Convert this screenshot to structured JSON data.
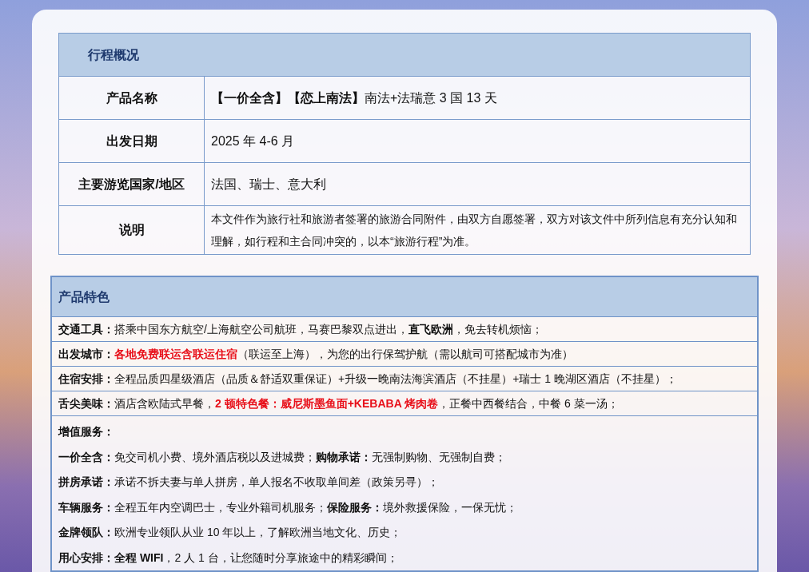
{
  "overview": {
    "title": "行程概况",
    "rows": [
      {
        "label": "产品名称",
        "value": "**【一价全含】【恋上南法】**南法+法瑞意 3 国 13 天",
        "kind": "large"
      },
      {
        "label": "出发日期",
        "value": "2025 年 4-6 月",
        "kind": "large"
      },
      {
        "label": "主要游览国家/地区",
        "value": "法国、瑞士、意大利",
        "kind": "large"
      },
      {
        "label": "说明",
        "value": "本文件作为旅行社和旅游者签署的旅游合同附件，由双方自愿签署，双方对该文件中所列信息有充分认知和理解，如行程和主合同冲突的，以本“旅游行程”为准。",
        "kind": "small"
      }
    ]
  },
  "features": {
    "title": "产品特色",
    "rows": [
      [
        {
          "text": "交通工具：",
          "kind": "emphasis"
        },
        {
          "text": "搭乘中国东方航空/上海航空公司航班，马赛巴黎双点进出，",
          "kind": "normal"
        },
        {
          "text": "直飞欧洲",
          "kind": "emphasis"
        },
        {
          "text": "，免去转机烦恼；",
          "kind": "normal"
        }
      ],
      [
        {
          "text": "出发城市：",
          "kind": "emphasis"
        },
        {
          "text": "各地免费联运含联运住宿",
          "kind": "highlight"
        },
        {
          "text": "（联运至上海），为您的出行保驾护航（需以航司可搭配城市为准）",
          "kind": "normal"
        }
      ],
      [
        {
          "text": "住宿安排：",
          "kind": "emphasis"
        },
        {
          "text": "全程品质四星级酒店（品质＆舒适双重保证）+升级一晚南法海滨酒店（不挂星）+瑞士 1 晚湖区酒店（不挂星）；",
          "kind": "normal"
        }
      ],
      [
        {
          "text": "舌尖美味：",
          "kind": "emphasis"
        },
        {
          "text": "酒店含欧陆式早餐，",
          "kind": "normal"
        },
        {
          "text": "2 顿特色餐：威尼斯墨鱼面+KEBABA 烤肉卷",
          "kind": "highlight"
        },
        {
          "text": "，正餐中西餐结合，中餐 6 菜一汤；",
          "kind": "normal"
        }
      ]
    ],
    "extra": [
      [
        {
          "text": "增值服务：",
          "kind": "emphasis"
        }
      ],
      [
        {
          "text": "一价全含：",
          "kind": "emphasis"
        },
        {
          "text": "免交司机小费、境外酒店税以及进城费；",
          "kind": "normal"
        },
        {
          "text": "购物承诺：",
          "kind": "emphasis"
        },
        {
          "text": "无强制购物、无强制自费；",
          "kind": "normal"
        }
      ],
      [
        {
          "text": "拼房承诺：",
          "kind": "emphasis"
        },
        {
          "text": "承诺不拆夫妻与单人拼房，单人报名不收取单间差（政策另寻）；",
          "kind": "normal"
        }
      ],
      [
        {
          "text": "车辆服务：",
          "kind": "emphasis"
        },
        {
          "text": "全程五年内空调巴士，专业外籍司机服务；",
          "kind": "normal"
        },
        {
          "text": "保险服务：",
          "kind": "emphasis"
        },
        {
          "text": "境外救援保险，一保无忧；",
          "kind": "normal"
        }
      ],
      [
        {
          "text": "金牌领队：",
          "kind": "emphasis"
        },
        {
          "text": "欧洲专业领队从业 10 年以上，了解欧洲当地文化、历史；",
          "kind": "normal"
        }
      ],
      [
        {
          "text": "用心安排：",
          "kind": "emphasis"
        },
        {
          "text": "全程 WIFI",
          "kind": "emphasis"
        },
        {
          "text": "，2 人 1 台，让您随时分享旅途中的精彩瞬间；",
          "kind": "normal"
        }
      ]
    ]
  }
}
